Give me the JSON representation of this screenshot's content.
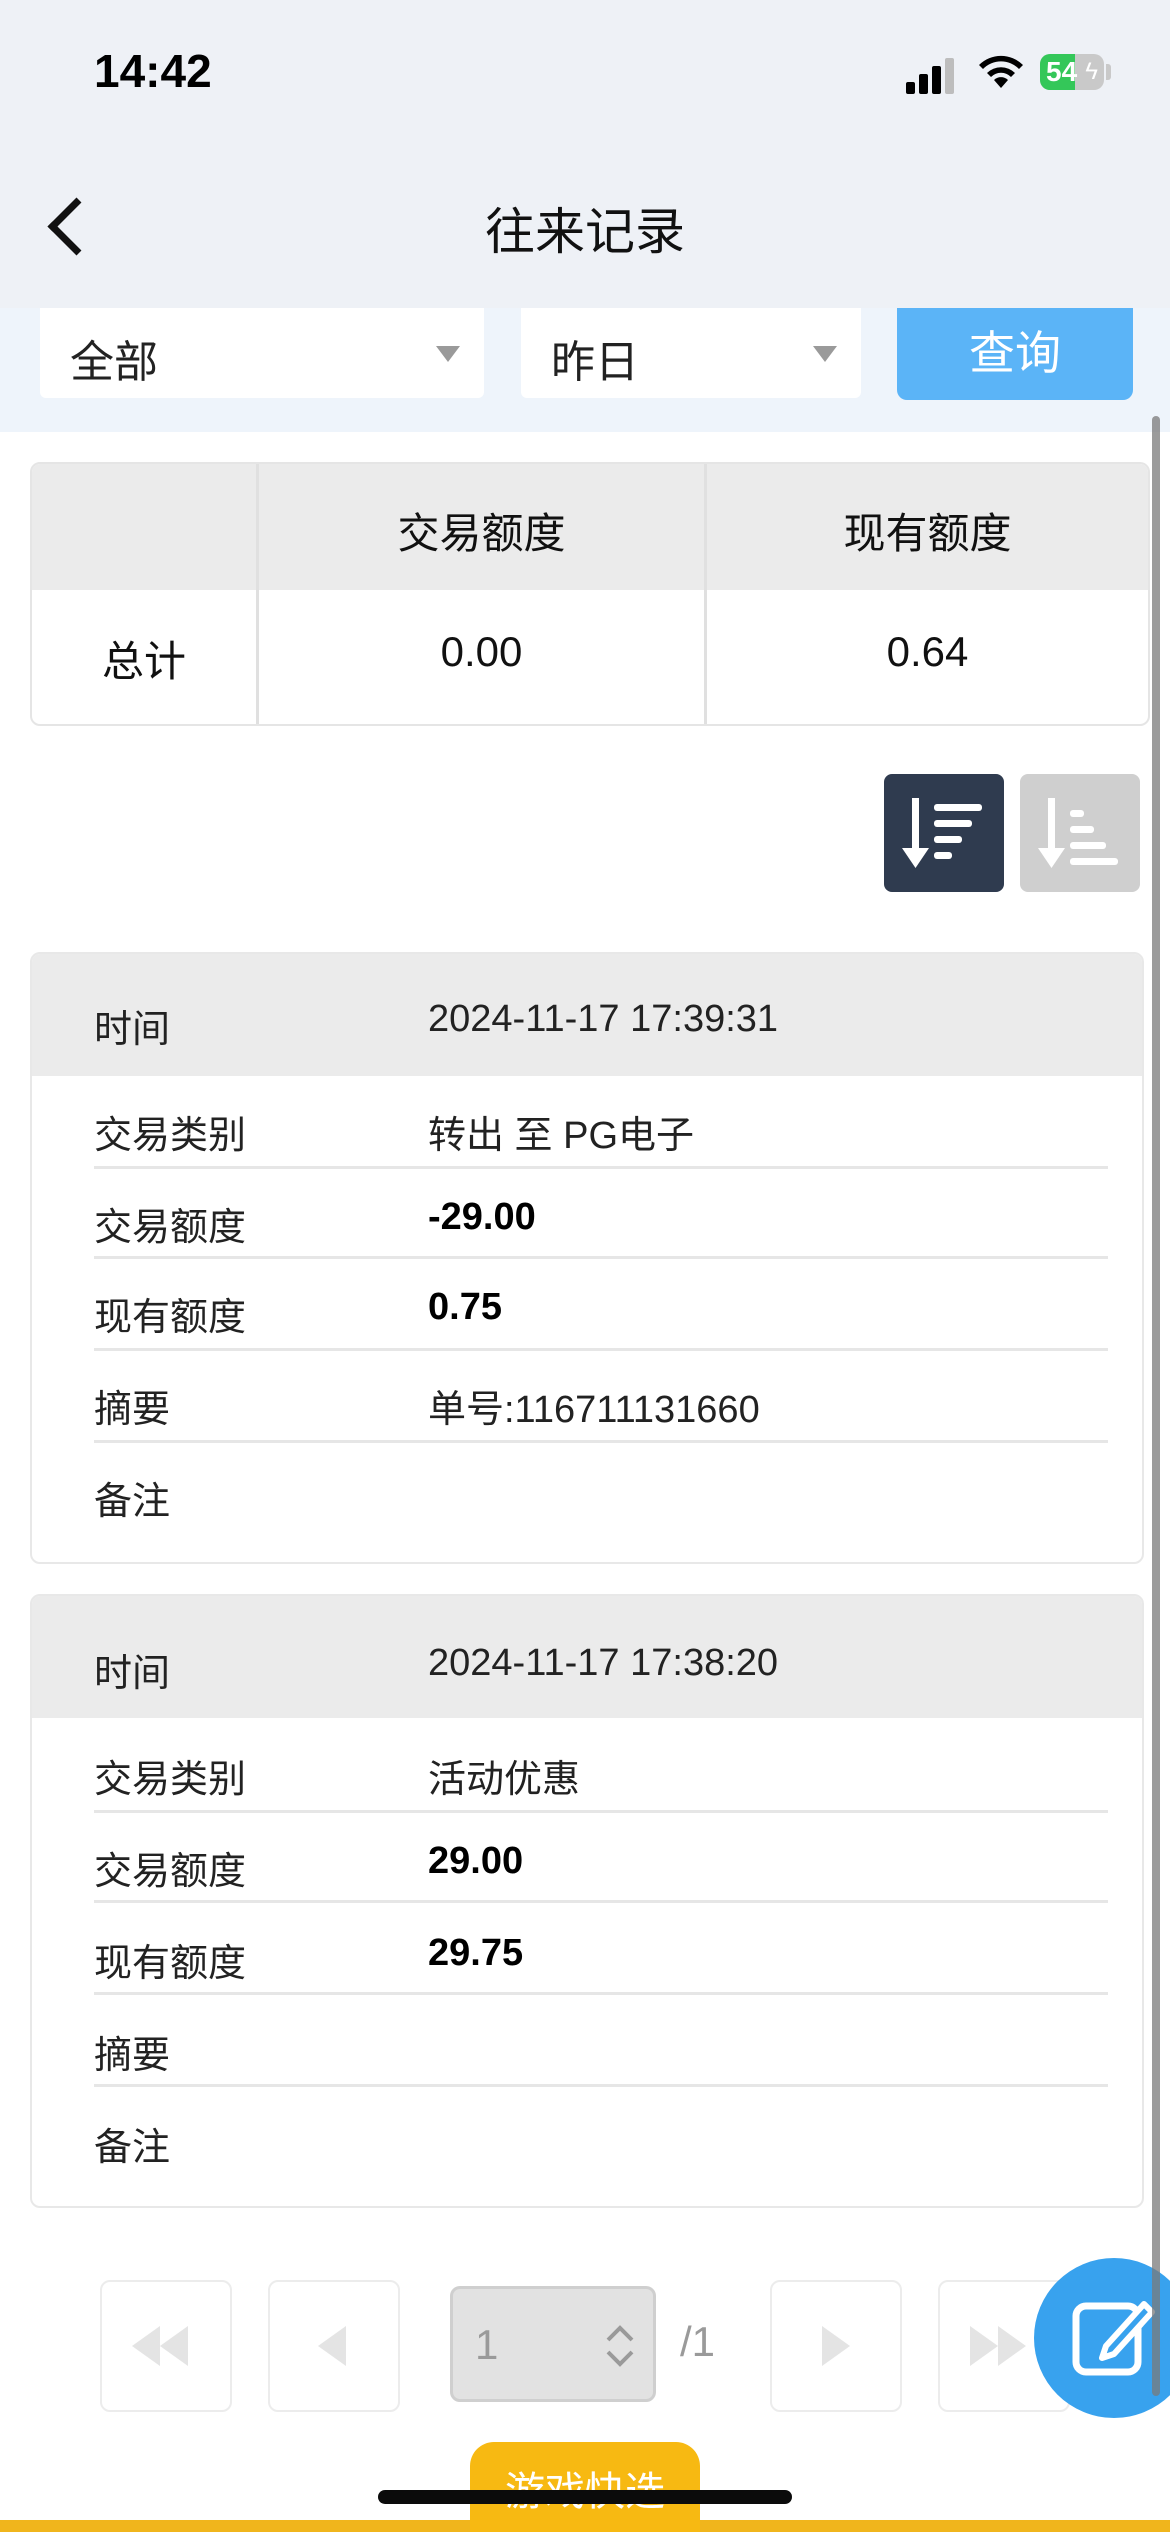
{
  "status_bar": {
    "time": "14:42",
    "battery": "54",
    "battery_level": 0.54
  },
  "nav": {
    "title": "往来记录"
  },
  "filters": {
    "type_value": "全部",
    "period_value": "昨日",
    "query_label": "查询"
  },
  "summary": {
    "headers": [
      "",
      "交易额度",
      "现有额度"
    ],
    "row_label": "总计",
    "trade_amount": "0.00",
    "current_amount": "0.64"
  },
  "records": [
    {
      "time_label": "时间",
      "time": "2024-11-17 17:39:31",
      "type_label": "交易类别",
      "type": "转出 至 PG电子",
      "amount_label": "交易额度",
      "amount": "-29.00",
      "balance_label": "现有额度",
      "balance": "0.75",
      "summary_label": "摘要",
      "summary": "单号:116711131660",
      "remark_label": "备注",
      "remark": ""
    },
    {
      "time_label": "时间",
      "time": "2024-11-17 17:38:20",
      "type_label": "交易类别",
      "type": "活动优惠",
      "amount_label": "交易额度",
      "amount": "29.00",
      "balance_label": "现有额度",
      "balance": "29.75",
      "summary_label": "摘要",
      "summary": "",
      "remark_label": "备注",
      "remark": ""
    }
  ],
  "pagination": {
    "current_page": "1",
    "total_text": "/1"
  },
  "bottom": {
    "game_tab_label": "游戏快选"
  },
  "colors": {
    "accent_blue": "#5bb4f7",
    "sort_active": "#2f3b4f",
    "sort_inactive": "#cfcfcf",
    "gold": "#f7b912"
  }
}
